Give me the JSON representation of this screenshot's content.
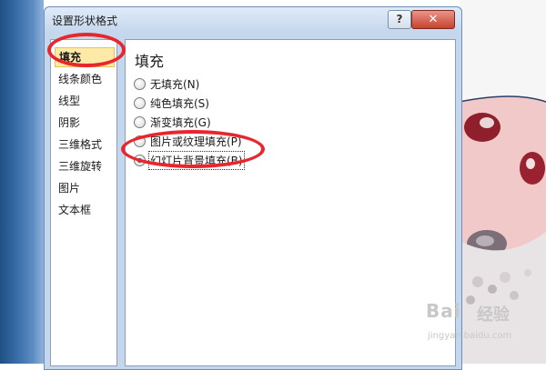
{
  "dialog": {
    "title": "设置形状格式",
    "help_label": "?",
    "close_label": "✕"
  },
  "sidebar": {
    "items": [
      {
        "label": "填充",
        "selected": true
      },
      {
        "label": "线条颜色",
        "selected": false
      },
      {
        "label": "线型",
        "selected": false
      },
      {
        "label": "阴影",
        "selected": false
      },
      {
        "label": "三维格式",
        "selected": false
      },
      {
        "label": "三维旋转",
        "selected": false
      },
      {
        "label": "图片",
        "selected": false
      },
      {
        "label": "文本框",
        "selected": false
      }
    ]
  },
  "fill_panel": {
    "title": "填充",
    "options": [
      {
        "label": "无填充(N)",
        "checked": false
      },
      {
        "label": "纯色填充(S)",
        "checked": false
      },
      {
        "label": "渐变填充(G)",
        "checked": false
      },
      {
        "label": "图片或纹理填充(P)",
        "checked": false
      },
      {
        "label": "幻灯片背景填充(B)",
        "checked": true
      }
    ]
  },
  "watermark": {
    "brand": "Bai",
    "brand_cn": "经验",
    "url": "jingyan.baidu.com"
  },
  "colors": {
    "annotation": "#e8262e",
    "selection": "#fde9a8",
    "dialog_frame": "#c5d7ed"
  }
}
